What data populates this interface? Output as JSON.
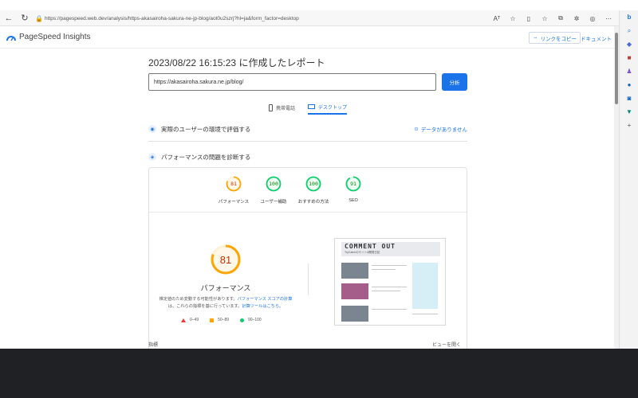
{
  "browser": {
    "url": "https://pagespeed.web.dev/analysis/https-akasairoha-sakura-ne-jp-blog/aot0u2szrj?hl=ja&form_factor=desktop",
    "reader_label": "Aᵀ"
  },
  "header": {
    "logo_text": "PageSpeed Insights",
    "copy_link_label": "リンクをコピー",
    "docs_label": "ドキュメント"
  },
  "report": {
    "title": "2023/08/22 16:15:23 に作成したレポート",
    "url_value": "https://akasairoha.sakura.ne.jp/blog/",
    "analyze_label": "分析"
  },
  "tabs": [
    {
      "label": "携帯電話",
      "icon": "phone-icon"
    },
    {
      "label": "デスクトップ",
      "icon": "desktop-icon"
    }
  ],
  "sections": {
    "field_title": "実際のユーザーの環境で評価する",
    "no_data_label": "データがありません",
    "diagnose_title": "パフォーマンスの問題を診断する"
  },
  "scores": [
    {
      "label": "パフォーマンス",
      "value": "81",
      "color": "#ffa400",
      "fraction": 0.81
    },
    {
      "label": "ユーザー補助",
      "value": "100",
      "color": "#0cce6b",
      "fraction": 1.0
    },
    {
      "label": "おすすめの方法",
      "value": "100",
      "color": "#0cce6b",
      "fraction": 1.0
    },
    {
      "label": "SEO",
      "value": "91",
      "color": "#0cce6b",
      "fraction": 0.91
    }
  ],
  "main_score": {
    "value": "81",
    "label": "パフォーマンス",
    "fraction": 0.81,
    "note_a": "推定値のため変動する可能性があります。",
    "note_link1": "パフォーマンス スコアの計算",
    "note_b": "は、これらの指標を基に行っています。",
    "note_link2": "計算ツールはこちら。"
  },
  "legend": [
    {
      "label": "0–49",
      "shape": "triangle",
      "color": "#ff3333"
    },
    {
      "label": "50–89",
      "shape": "square",
      "color": "#ffa400"
    },
    {
      "label": "90–100",
      "shape": "circle",
      "color": "#0cce6b"
    }
  ],
  "screenshot": {
    "title": "COMMENT OUT",
    "subtitle": "TryCatchのサイト&開発日記"
  },
  "bottom": {
    "left_label": "指標",
    "right_label": "ビューを開く"
  }
}
